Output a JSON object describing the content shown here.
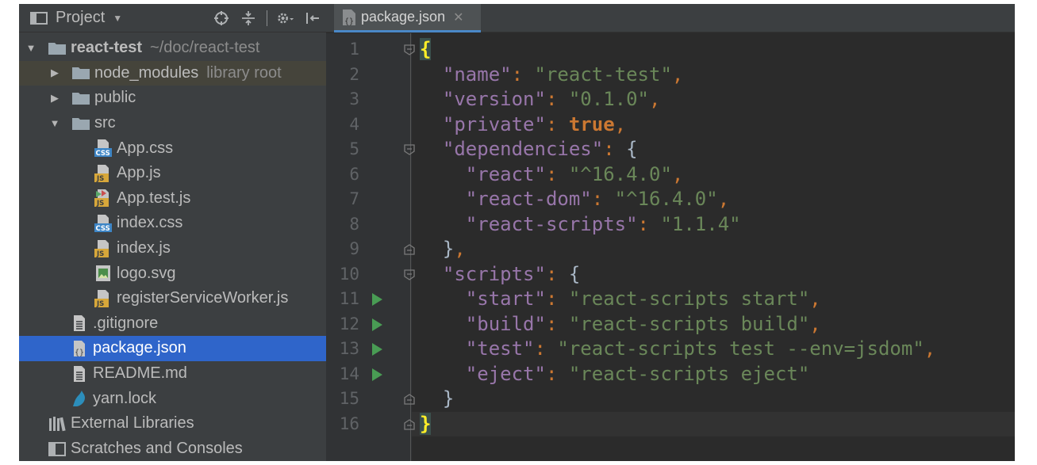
{
  "project_panel": {
    "title": "Project",
    "tree": [
      {
        "label": "react-test",
        "hint": "~/doc/react-test",
        "arrow": "▼",
        "icon": "folder-icon",
        "depth": 0,
        "bold": true
      },
      {
        "label": "node_modules",
        "hint": "library root",
        "arrow": "▶",
        "icon": "folder-icon",
        "depth": 1
      },
      {
        "label": "public",
        "hint": "",
        "arrow": "▶",
        "icon": "folder-icon",
        "depth": 1
      },
      {
        "label": "src",
        "hint": "",
        "arrow": "▼",
        "icon": "folder-icon",
        "depth": 1
      },
      {
        "label": "App.css",
        "icon": "css-file-icon",
        "depth": 2
      },
      {
        "label": "App.js",
        "icon": "js-file-icon",
        "depth": 2
      },
      {
        "label": "App.test.js",
        "icon": "js-test-file-icon",
        "depth": 2
      },
      {
        "label": "index.css",
        "icon": "css-file-icon",
        "depth": 2
      },
      {
        "label": "index.js",
        "icon": "js-file-icon",
        "depth": 2
      },
      {
        "label": "logo.svg",
        "icon": "image-file-icon",
        "depth": 2
      },
      {
        "label": "registerServiceWorker.js",
        "icon": "js-file-icon",
        "depth": 2
      },
      {
        "label": ".gitignore",
        "icon": "text-file-icon",
        "depth": 1
      },
      {
        "label": "package.json",
        "icon": "json-file-icon",
        "depth": 1,
        "selected": true
      },
      {
        "label": "README.md",
        "icon": "text-file-icon",
        "depth": 1
      },
      {
        "label": "yarn.lock",
        "icon": "yarn-icon",
        "depth": 1
      },
      {
        "label": "External Libraries",
        "icon": "libraries-icon",
        "depth": 0
      },
      {
        "label": "Scratches and Consoles",
        "icon": "scratches-icon",
        "depth": 0
      }
    ]
  },
  "editor": {
    "tab_label": "package.json",
    "line_numbers": [
      "1",
      "2",
      "3",
      "4",
      "5",
      "6",
      "7",
      "8",
      "9",
      "10",
      "11",
      "12",
      "13",
      "14",
      "15",
      "16"
    ],
    "run_lines": [
      11,
      12,
      13,
      14
    ],
    "code": {
      "l1_open": "{",
      "name_key": "\"name\"",
      "name_val": "\"react-test\"",
      "version_key": "\"version\"",
      "version_val": "\"0.1.0\"",
      "private_key": "\"private\"",
      "private_val": "true",
      "deps_key": "\"dependencies\"",
      "react_key": "\"react\"",
      "react_val": "\"^16.4.0\"",
      "reactdom_key": "\"react-dom\"",
      "reactdom_val": "\"^16.4.0\"",
      "reactscripts_key": "\"react-scripts\"",
      "reactscripts_val": "\"1.1.4\"",
      "scripts_key": "\"scripts\"",
      "start_key": "\"start\"",
      "start_val": "\"react-scripts start\"",
      "build_key": "\"build\"",
      "build_val": "\"react-scripts build\"",
      "test_key": "\"test\"",
      "test_val": "\"react-scripts test --env=jsdom\"",
      "eject_key": "\"eject\"",
      "eject_val": "\"react-scripts eject\"",
      "l16_close": "}"
    }
  },
  "colors": {
    "panel_bg": "#3c3f41",
    "editor_bg": "#2b2b2b",
    "selection": "#2f65ca",
    "key": "#9876aa",
    "string": "#6a8759",
    "keyword": "#cc7832"
  }
}
